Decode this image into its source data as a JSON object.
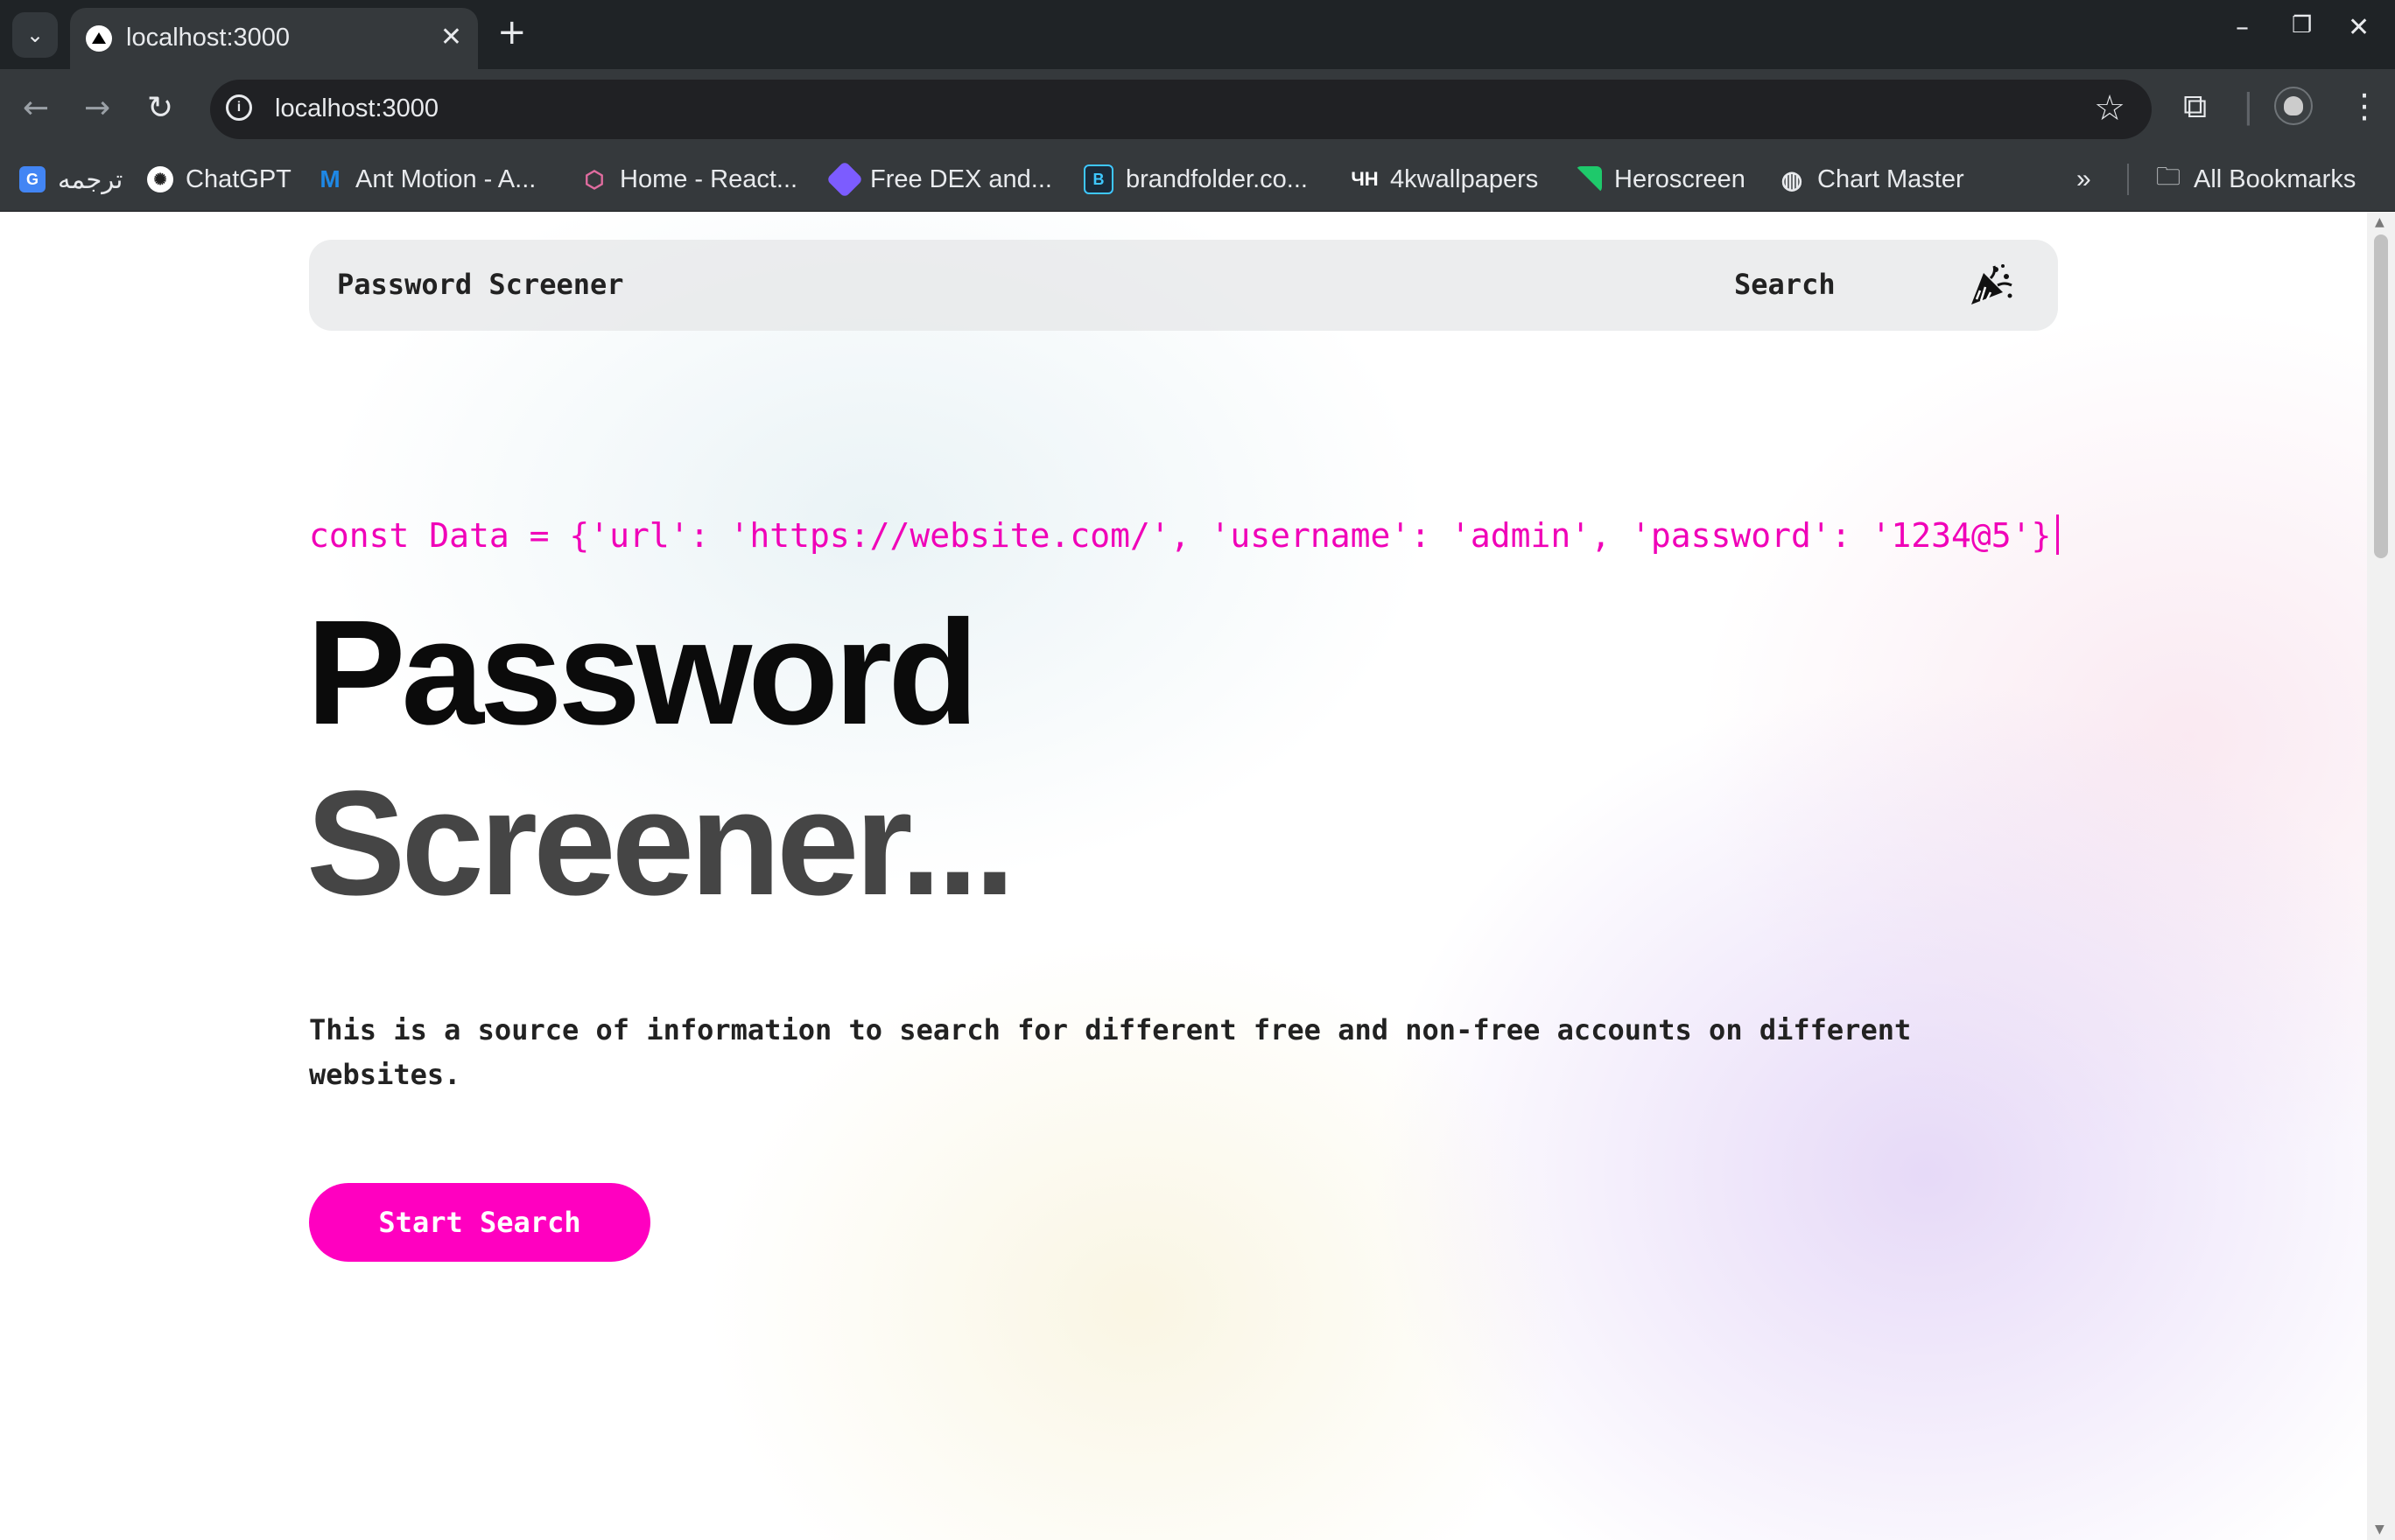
{
  "browser": {
    "tab_title": "localhost:3000",
    "url": "localhost:3000",
    "bookmarks": [
      {
        "label": "ترجمه",
        "icon": "google-translate-icon"
      },
      {
        "label": "ChatGPT",
        "icon": "chatgpt-icon"
      },
      {
        "label": "Ant Motion - A...",
        "icon": "ant-motion-icon"
      },
      {
        "label": "Home - React...",
        "icon": "react-icon"
      },
      {
        "label": "Free DEX and...",
        "icon": "dex-icon"
      },
      {
        "label": "brandfolder.co...",
        "icon": "brandfolder-icon"
      },
      {
        "label": "4kwallpapers",
        "icon": "4kwallpapers-icon"
      },
      {
        "label": "Heroscreen",
        "icon": "heroscreen-icon"
      },
      {
        "label": "Chart Master",
        "icon": "globe-icon"
      }
    ],
    "all_bookmarks_label": "All Bookmarks"
  },
  "site": {
    "nav": {
      "brand": "Password Screener",
      "search": "Search"
    },
    "code_line": "const Data = {'url': 'https://website.com/', 'username': 'admin', 'password': '1234@5'}",
    "headline_line1": "Password",
    "headline_line2": "Screener...",
    "description": "This is a source of information to search for different free and non-free accounts on different websites.",
    "cta_label": "Start Search"
  },
  "colors": {
    "accent": "#ff00c0",
    "code_text": "#f000b8",
    "chrome_dark": "#1f2326",
    "chrome_toolbar": "#35393c"
  }
}
